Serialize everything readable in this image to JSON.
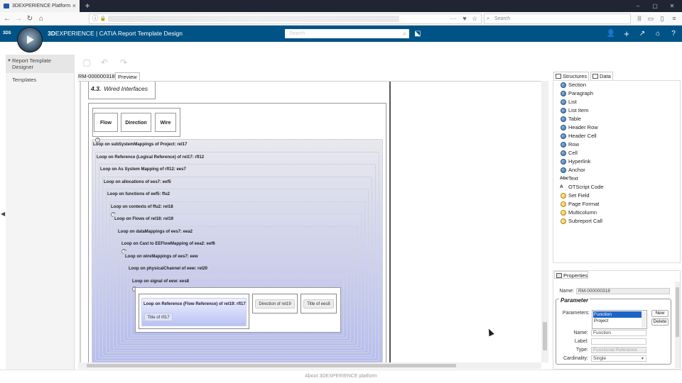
{
  "browser": {
    "tab_title": "3DEXPERIENCE Platform",
    "tab_close": "×",
    "new_tab": "+",
    "search_placeholder": "Search",
    "win_min": "–",
    "win_max": "▢",
    "win_close": "✕",
    "nav_back": "←",
    "nav_forward": "→",
    "nav_reload": "↻",
    "nav_home": "⌂",
    "url_info": "ⓘ",
    "url_lock": "🔒",
    "url_more": "···",
    "pocket": "♥",
    "star": "☆",
    "library": "|||",
    "reader": "▭",
    "sidebar_toggle": "▯",
    "menu": "≡",
    "search_glyph": "⌕"
  },
  "app": {
    "logo": "3DS",
    "title_bold": "3D",
    "title_rest": "EXPERIENCE | CATIA  Report Template Design",
    "search_placeholder": "Search",
    "search_glyph": "⌕",
    "tag_glyph": "⬕",
    "header_icons": [
      "👤",
      "+",
      "↗",
      "⌂",
      "?"
    ]
  },
  "left_panel": {
    "header_tri": "▼",
    "header_label": "Report Template Designer",
    "items": [
      "Templates"
    ],
    "collapse_glyph": "◀"
  },
  "toolbar": {
    "new_glyph": "▢",
    "undo_glyph": "↶",
    "redo_glyph": "↷"
  },
  "editor": {
    "tabs": [
      "RM-000000318",
      "Preview"
    ],
    "section_number": "4.3.",
    "section_title": "Wired Interfaces",
    "headers": [
      "Flow",
      "Direction",
      "Wire"
    ],
    "qmark": "?",
    "loops": [
      "Loop on subSystemMappings of Project: rel17",
      "Loop on Reference (Logical Reference) of rel17: rfl12",
      "Loop on As System Mapping of rfl12: ees7",
      "Loop on allocations of ees7: eef5",
      "Loop on functions of eef5: ffu2",
      "Loop on contexts of ffu2: rel18",
      "Loop on Flows of rel18: rel19",
      "Loop on dataMappings of ees7: eea2",
      "Loop on Cast to EEFlowMapping of eea2: eef6",
      "Loop on wireMappings of ees7: eew",
      "Loop on physicalChannel of eew: rel20",
      "Loop on signal of eew: ees8"
    ],
    "inner_loop": "Loop on Reference (Flow Reference) of rel19: rfl17",
    "cells": [
      "Title of rfl17",
      "Direction of rel19",
      "Title of ees8"
    ]
  },
  "structures": {
    "tabs": [
      "Structures",
      "Data"
    ],
    "items": [
      {
        "label": "Section",
        "icon": "blue-ball-icon"
      },
      {
        "label": "Paragraph",
        "icon": "blue-ball-icon"
      },
      {
        "label": "List",
        "icon": "blue-ball-icon"
      },
      {
        "label": "List Item",
        "icon": "blue-ball-icon"
      },
      {
        "label": "Table",
        "icon": "blue-ball-icon"
      },
      {
        "label": "Header Row",
        "icon": "blue-ball-icon"
      },
      {
        "label": "Header Cell",
        "icon": "blue-ball-icon"
      },
      {
        "label": "Row",
        "icon": "blue-ball-icon"
      },
      {
        "label": "Cell",
        "icon": "blue-ball-icon"
      },
      {
        "label": "Hyperlink",
        "icon": "blue-ball-icon"
      },
      {
        "label": "Anchor",
        "icon": "blue-ball-icon"
      },
      {
        "label": "Text",
        "icon": "abc-icon"
      },
      {
        "label": "OTScript Code",
        "icon": "script-icon"
      },
      {
        "label": "Set Field",
        "icon": "yellow-ball-icon"
      },
      {
        "label": "Page Format",
        "icon": "yellow-ball-icon"
      },
      {
        "label": "Multicolumn",
        "icon": "yellow-ball-icon"
      },
      {
        "label": "Subreport Call",
        "icon": "yellow-ball-icon"
      }
    ],
    "abc_glyph": "Abc",
    "script_glyph": "A"
  },
  "properties": {
    "title": "Properties",
    "name_label": "Name:",
    "name_value": "RM-000000318",
    "parameter_legend": "Parameter",
    "parameters_label": "Parameters:",
    "parameters_options": [
      "Function",
      "Project"
    ],
    "new_button": "New",
    "delete_button": "Delete",
    "pname_label": "Name:",
    "pname_value": "Function",
    "label_label": "Label:",
    "label_value": "",
    "type_label": "Type:",
    "type_value": "Functional Reference",
    "cardinality_label": "Cardinality:",
    "cardinality_value": "Single"
  },
  "footer": {
    "text": "About 3DEXPERIENCE platform"
  },
  "colors": {
    "app_bar": "#005386",
    "selection": "#1e64c8",
    "loop_gradient_end": "#aab4ee"
  }
}
